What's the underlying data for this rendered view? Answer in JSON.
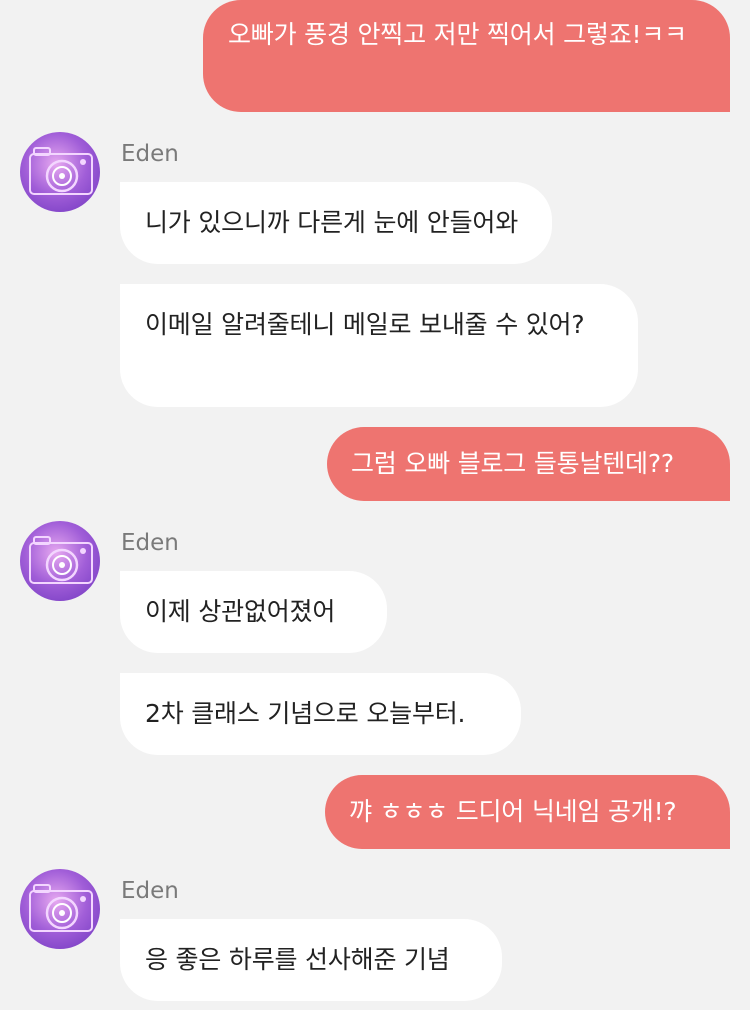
{
  "contact": {
    "name": "Eden",
    "avatar_icon": "camera-avatar-icon"
  },
  "colors": {
    "outgoing_bubble": "#ee7470",
    "incoming_bubble": "#ffffff",
    "background": "#f2f2f2",
    "sender_name": "#7a7a7a"
  },
  "messages": [
    {
      "direction": "out",
      "text": "오빠가 풍경 안찍고 저만 찍어서 그렇죠!ㅋㅋ"
    },
    {
      "direction": "in",
      "sender": "Eden",
      "text": "니가 있으니까 다른게 눈에 안들어와"
    },
    {
      "direction": "in",
      "text": "이메일 알려줄테니 메일로 보내줄 수 있어?"
    },
    {
      "direction": "out",
      "text": "그럼 오빠 블로그 들통날텐데??"
    },
    {
      "direction": "in",
      "sender": "Eden",
      "text": "이제 상관없어졌어"
    },
    {
      "direction": "in",
      "text": "2차 클래스 기념으로 오늘부터."
    },
    {
      "direction": "out",
      "text": "꺄 ㅎㅎㅎ 드디어 닉네임 공개!?"
    },
    {
      "direction": "in",
      "sender": "Eden",
      "text": "응 좋은 하루를 선사해준 기념"
    }
  ]
}
